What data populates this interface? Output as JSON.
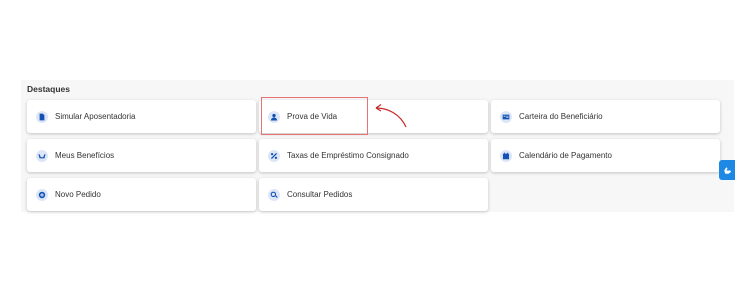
{
  "section": {
    "title": "Destaques"
  },
  "cards": [
    {
      "label": "Simular Aposentadoria",
      "icon": "document-icon"
    },
    {
      "label": "Prova de Vida",
      "icon": "user-icon"
    },
    {
      "label": "Carteira do Beneficiário",
      "icon": "id-card-icon"
    },
    {
      "label": "Meus Benefícios",
      "icon": "hands-icon"
    },
    {
      "label": "Taxas de Empréstimo Consignado",
      "icon": "percent-icon"
    },
    {
      "label": "Calendário de Pagamento",
      "icon": "calendar-icon"
    },
    {
      "label": "Novo Pedido",
      "icon": "plus-circle-icon"
    },
    {
      "label": "Consultar Pedidos",
      "icon": "search-icon"
    }
  ],
  "accent_color": "#1351b4",
  "accessibility_button": {
    "icon": "sign-language-icon"
  }
}
